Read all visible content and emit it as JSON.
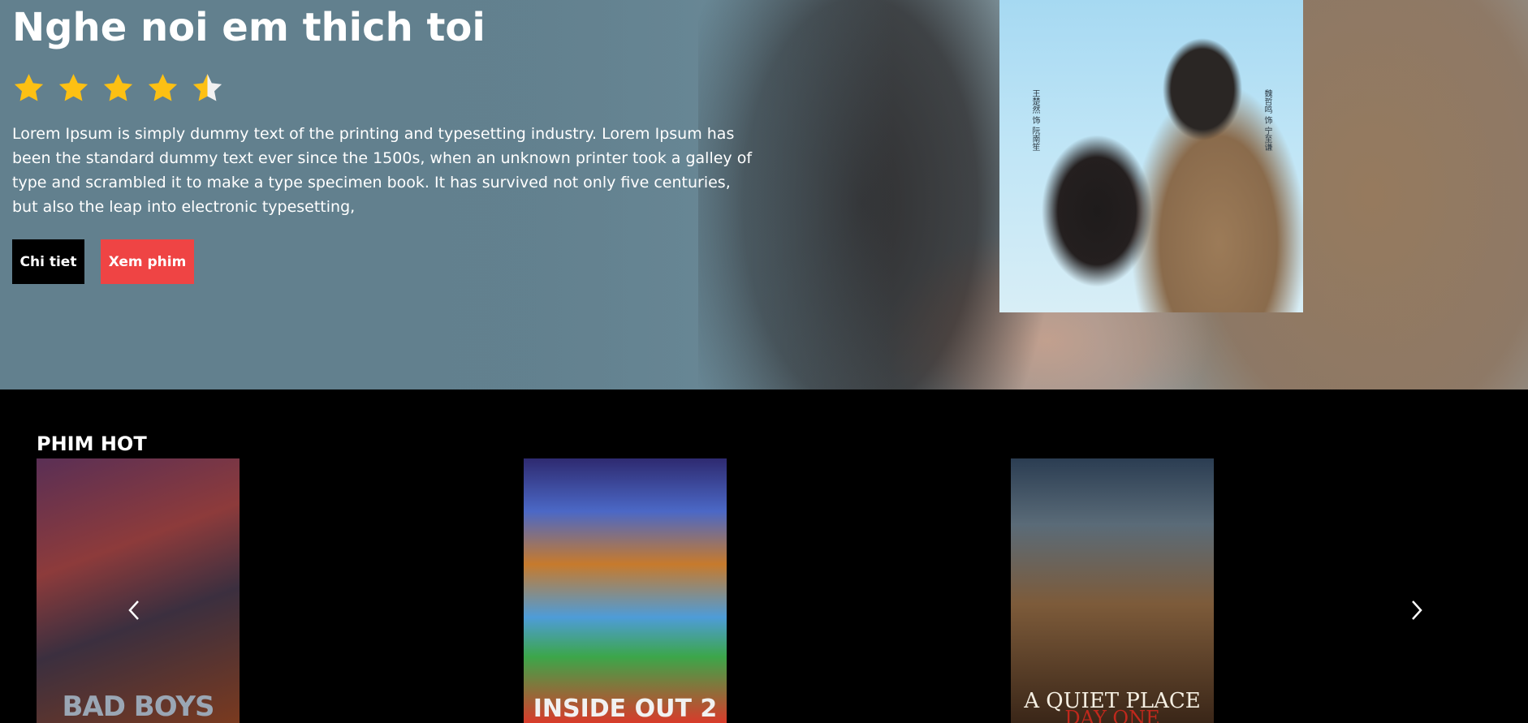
{
  "hero": {
    "title": "Nghe noi em thich toi",
    "rating": 4.5,
    "rating_max": 5,
    "description": "Lorem Ipsum is simply dummy text of the printing and typesetting industry. Lorem Ipsum has been the standard dummy text ever since the 1500s, when an unknown printer took a galley of type and scrambled it to make a type specimen book. It has survived not only five centuries, but also the leap into electronic typesetting,",
    "detail_button": "Chi tiet",
    "watch_button": "Xem phim",
    "poster_text_left": "王楚然 饰 阮南笙",
    "poster_text_right": "魏哲鸣 饰 宁至谦"
  },
  "colors": {
    "star": "#fdc013",
    "watch_button": "#ef4444",
    "detail_button": "#000000",
    "background": "#000000"
  },
  "section": {
    "title": "PHIM HOT"
  },
  "movies": [
    {
      "title": "BAD BOYS"
    },
    {
      "title": "INSIDE OUT 2"
    },
    {
      "title": "A QUIET PLACE",
      "subtitle": "DAY ONE"
    }
  ],
  "icons": {
    "prev": "chevron-left-icon",
    "next": "chevron-right-icon"
  }
}
